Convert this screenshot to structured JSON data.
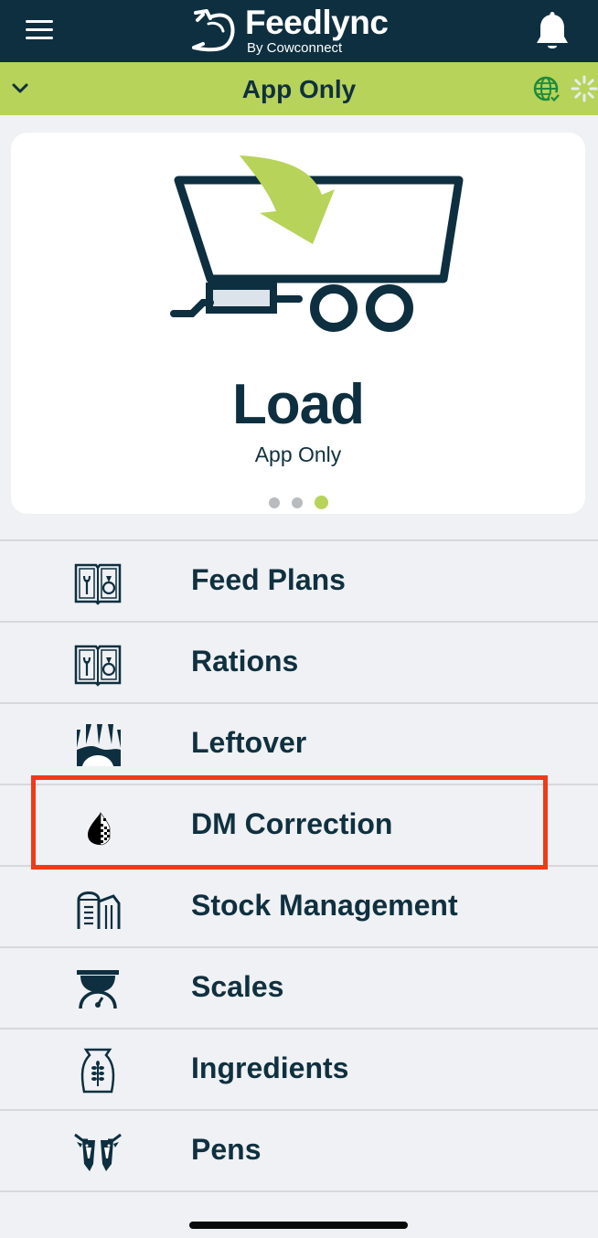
{
  "header": {
    "brand_name": "Feedlync",
    "brand_sub": "By Cowconnect",
    "colors": {
      "bar": "#0e2f3f",
      "accent": "#b7d35a"
    },
    "icons": [
      "menu-icon",
      "feedlync-logo-icon",
      "bell-icon"
    ]
  },
  "mode_bar": {
    "title": "App Only",
    "icons": [
      "chevron-down-icon",
      "globe-check-icon",
      "loading-spinner-icon"
    ]
  },
  "carousel": {
    "title": "Load",
    "subtitle": "App Only",
    "icon": "feed-wagon-load-icon",
    "pages": 3,
    "active_page": 3
  },
  "menu": {
    "items": [
      {
        "label": "Feed Plans",
        "icon": "feed-plans-book-icon"
      },
      {
        "label": "Rations",
        "icon": "rations-book-icon"
      },
      {
        "label": "Leftover",
        "icon": "leftover-icon"
      },
      {
        "label": "DM Correction",
        "icon": "dm-drop-icon",
        "highlighted": true
      },
      {
        "label": "Stock Management",
        "icon": "silo-icon"
      },
      {
        "label": "Scales",
        "icon": "scales-icon"
      },
      {
        "label": "Ingredients",
        "icon": "grain-sack-icon"
      },
      {
        "label": "Pens",
        "icon": "cows-icon"
      }
    ]
  },
  "annotation": {
    "highlight_color": "#f03a17"
  }
}
